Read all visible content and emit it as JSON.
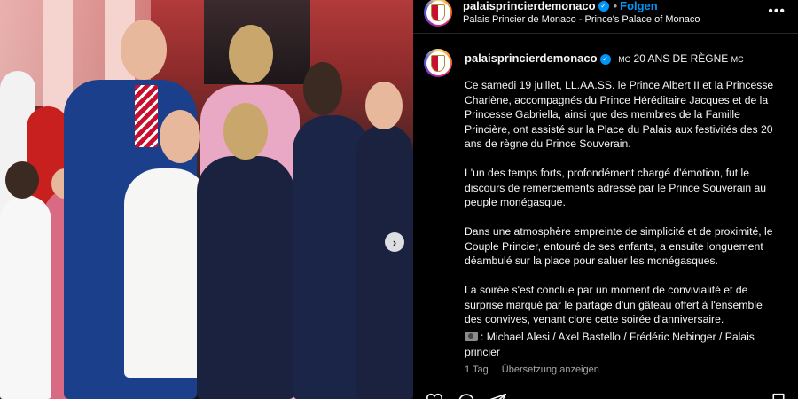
{
  "post": {
    "username": "palaisprincierdemonaco",
    "follow_label": "Folgen",
    "location": "Palais Princier de Monaco - Prince's Palace of Monaco",
    "more_label": "•••",
    "caption_title_prefix": "MC",
    "caption_title": "20 ANS DE RÈGNE",
    "caption_title_suffix": "MC",
    "paragraphs": [
      "Ce samedi 19 juillet, LL.AA.SS. le Prince Albert II et la Princesse Charlène, accompagnés du Prince Héréditaire Jacques et de la Princesse Gabriella, ainsi que des membres de la Famille Princière, ont assisté sur la Place du Palais aux festivités des 20 ans de règne du Prince Souverain.",
      "L'un des temps forts, profondément chargé d'émotion, fut le discours de remerciements adressé par le Prince Souverain au peuple monégasque.",
      "Dans une atmosphère empreinte de simplicité et de proximité, le Couple Princier, entouré de ses enfants, a ensuite longuement déambulé sur la place pour saluer les monégasques.",
      "La soirée s'est conclue par un moment de convivialité et de surprise marqué par le partage d'un gâteau offert à l'ensemble des convives, venant clore cette soirée d'anniversaire."
    ],
    "credits": ": Michael Alesi / Axel Bastello / Frédéric Nebinger / Palais princier",
    "time_ago": "1 Tag",
    "translate_label": "Übersetzung anzeigen"
  },
  "photo": {
    "carousel_next": "›"
  },
  "icons": {
    "verified": "verified-badge-icon",
    "more": "more-options-icon",
    "camera": "camera-icon",
    "like": "heart-icon",
    "comment": "comment-icon",
    "share": "share-icon",
    "save": "bookmark-icon",
    "next": "chevron-right-icon"
  },
  "colors": {
    "accent": "#0095f6",
    "background": "#000000",
    "secondary_text": "#a8a8a8"
  }
}
